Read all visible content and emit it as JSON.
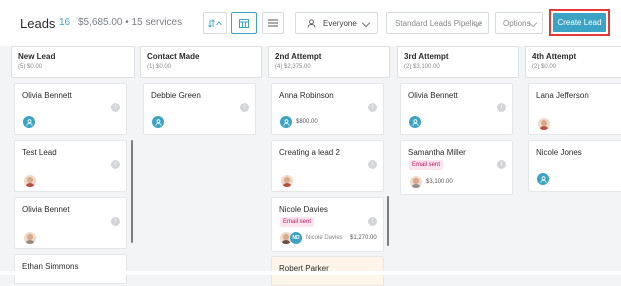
{
  "header": {
    "title": "Leads",
    "count": "16",
    "total": "$5,685.00 • 15 services",
    "sort_icon": "sort-icon",
    "owner_filter": "Everyone",
    "pipeline": "Standard Leads Pipeline",
    "options": "Options",
    "create": "Create Lead"
  },
  "columns": [
    {
      "name": "New Lead",
      "summary": "(5) $0.00",
      "cards": [
        {
          "name": "Olivia Bennett",
          "avatar": "blue",
          "amount": "",
          "badge": ""
        },
        {
          "name": "Test Lead",
          "avatar": "photo",
          "amount": "",
          "badge": ""
        },
        {
          "name": "Olivia Bennet",
          "avatar": "photo",
          "amount": "",
          "badge": ""
        },
        {
          "name": "Ethan Simmons",
          "avatar": "",
          "amount": "",
          "badge": ""
        }
      ]
    },
    {
      "name": "Contact Made",
      "summary": "(1) $0.00",
      "cards": [
        {
          "name": "Debbie Green",
          "avatar": "blue",
          "amount": "",
          "badge": ""
        }
      ]
    },
    {
      "name": "2nd Attempt",
      "summary": "(4) $2,375.00",
      "cards": [
        {
          "name": "Anna Robinson",
          "avatar": "blue",
          "amount": "$800.00",
          "badge": ""
        },
        {
          "name": "Creating a lead 2",
          "avatar": "photo",
          "amount": "",
          "badge": ""
        },
        {
          "name": "Nicole Davies",
          "avatar": "photo",
          "amount": "$1,270.00",
          "badge": "Email sent",
          "assignee_initials": "ND",
          "assignee": "Nicole Davies"
        },
        {
          "name": "Robert Parker",
          "avatar": "",
          "amount": "",
          "badge": ""
        }
      ]
    },
    {
      "name": "3rd Attempt",
      "summary": "(2) $3,100.00",
      "cards": [
        {
          "name": "Olivia Bennett",
          "avatar": "blue",
          "amount": "",
          "badge": ""
        },
        {
          "name": "Samantha Miller",
          "avatar": "photo",
          "amount": "$3,100.00",
          "badge": "Email sent"
        }
      ]
    },
    {
      "name": "4th Attempt",
      "summary": "(2) $0.00",
      "cards": [
        {
          "name": "Lana Jefferson",
          "avatar": "photo",
          "amount": "",
          "badge": ""
        },
        {
          "name": "Nicole Jones",
          "avatar": "blue",
          "amount": "",
          "badge": ""
        }
      ]
    }
  ],
  "colors": {
    "accent": "#3ba3c3",
    "highlight": "#e53935",
    "badge_bg": "#fde4ef",
    "badge_text": "#c2185b"
  }
}
